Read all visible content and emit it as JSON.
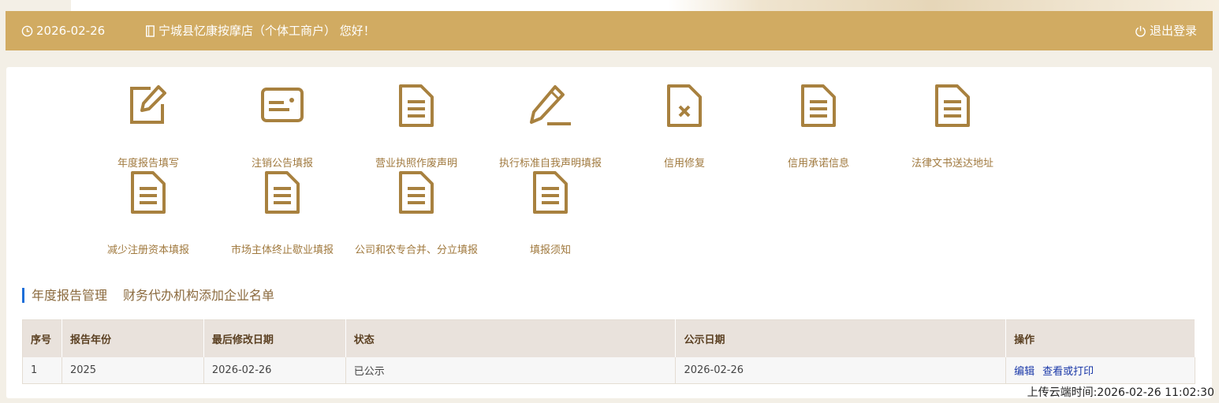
{
  "header": {
    "date": "2026-02-26",
    "shop_greeting": "宁城县忆康按摩店（个体工商户） 您好！",
    "logout_label": "退出登录",
    "accent_color": "#d1ab62"
  },
  "tiles": [
    {
      "label": "年度报告填写",
      "icon": "edit-icon"
    },
    {
      "label": "注销公告填报",
      "icon": "id-card-icon"
    },
    {
      "label": "营业执照作废声明",
      "icon": "document-icon"
    },
    {
      "label": "执行标准自我声明填报",
      "icon": "pen-icon"
    },
    {
      "label": "信用修复",
      "icon": "document-x-icon"
    },
    {
      "label": "信用承诺信息",
      "icon": "document-icon"
    },
    {
      "label": "法律文书送达地址",
      "icon": "document-icon"
    },
    {
      "label": "减少注册资本填报",
      "icon": "document-icon"
    },
    {
      "label": "市场主体终止歇业填报",
      "icon": "document-icon"
    },
    {
      "label": "公司和农专合并、分立填报",
      "icon": "document-icon"
    },
    {
      "label": "填报须知",
      "icon": "document-icon"
    }
  ],
  "section_tabs": [
    "年度报告管理",
    "财务代办机构添加企业名单"
  ],
  "table": {
    "columns": [
      "序号",
      "报告年份",
      "最后修改日期",
      "状态",
      "公示日期",
      "操作"
    ],
    "rows": [
      {
        "no": "1",
        "year": "2025",
        "modified": "2026-02-26",
        "status": "已公示",
        "published": "2026-02-26",
        "actions": [
          "编辑",
          "查看或打印"
        ]
      }
    ]
  },
  "footer": {
    "upload_time": "上传云端时间:2026-02-26 11:02:30"
  }
}
